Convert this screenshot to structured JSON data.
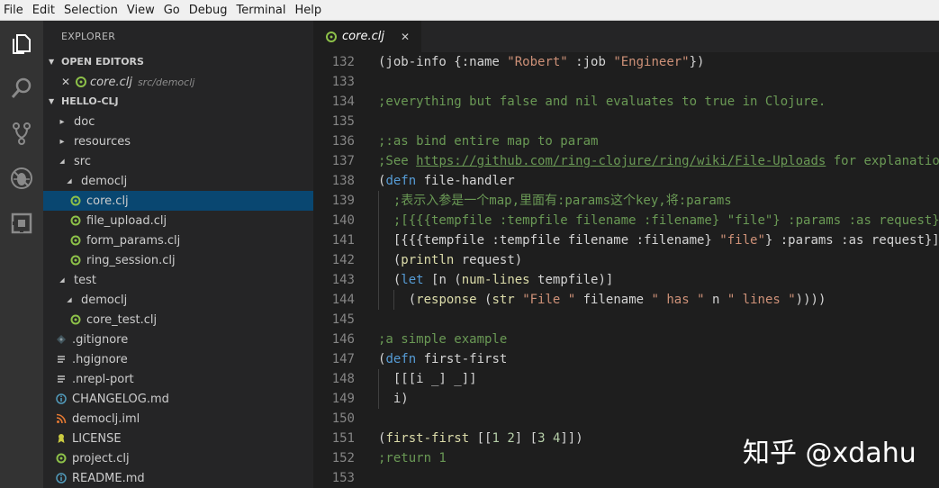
{
  "menu": [
    "File",
    "Edit",
    "Selection",
    "View",
    "Go",
    "Debug",
    "Terminal",
    "Help"
  ],
  "sidebar": {
    "title": "EXPLORER",
    "open_editors_label": "OPEN EDITORS",
    "open_editor": {
      "close_glyph": "✕",
      "name": "core.clj",
      "path": "src/democlj"
    },
    "project_label": "HELLO-CLJ",
    "tree": [
      {
        "label": "doc",
        "type": "folder-collapsed",
        "indent": 0
      },
      {
        "label": "resources",
        "type": "folder-collapsed",
        "indent": 0
      },
      {
        "label": "src",
        "type": "folder-open",
        "indent": 0
      },
      {
        "label": "democlj",
        "type": "folder-open",
        "indent": 1
      },
      {
        "label": "core.clj",
        "type": "clj",
        "indent": 2,
        "selected": true
      },
      {
        "label": "file_upload.clj",
        "type": "clj",
        "indent": 2
      },
      {
        "label": "form_params.clj",
        "type": "clj",
        "indent": 2
      },
      {
        "label": "ring_session.clj",
        "type": "clj",
        "indent": 2
      },
      {
        "label": "test",
        "type": "folder-open",
        "indent": 0
      },
      {
        "label": "democlj",
        "type": "folder-open",
        "indent": 1
      },
      {
        "label": "core_test.clj",
        "type": "clj",
        "indent": 2
      },
      {
        "label": ".gitignore",
        "type": "git",
        "indent": 0
      },
      {
        "label": ".hgignore",
        "type": "text",
        "indent": 0
      },
      {
        "label": ".nrepl-port",
        "type": "text",
        "indent": 0
      },
      {
        "label": "CHANGELOG.md",
        "type": "info",
        "indent": 0
      },
      {
        "label": "democlj.iml",
        "type": "rss",
        "indent": 0
      },
      {
        "label": "LICENSE",
        "type": "license",
        "indent": 0
      },
      {
        "label": "project.clj",
        "type": "clj",
        "indent": 0
      },
      {
        "label": "README.md",
        "type": "info",
        "indent": 0
      }
    ]
  },
  "tab": {
    "label": "core.clj",
    "close_glyph": "✕"
  },
  "editor": {
    "lines": [
      {
        "n": "132",
        "guides": 0,
        "tokens": [
          [
            "plain",
            "(job-info {:name "
          ],
          [
            "string",
            "\"Robert\""
          ],
          [
            "plain",
            " :job "
          ],
          [
            "string",
            "\"Engineer\""
          ],
          [
            "plain",
            "})"
          ]
        ]
      },
      {
        "n": "133",
        "guides": 0,
        "tokens": []
      },
      {
        "n": "134",
        "guides": 0,
        "tokens": [
          [
            "comment",
            ";everything but false and nil evaluates to true in Clojure."
          ]
        ]
      },
      {
        "n": "135",
        "guides": 0,
        "tokens": []
      },
      {
        "n": "136",
        "guides": 0,
        "tokens": [
          [
            "comment",
            ";:as bind entire map to param"
          ]
        ]
      },
      {
        "n": "137",
        "guides": 0,
        "tokens": [
          [
            "comment",
            ";See "
          ],
          [
            "link",
            "https://github.com/ring-clojure/ring/wiki/File-Uploads"
          ],
          [
            "comment",
            " for explanation"
          ]
        ]
      },
      {
        "n": "138",
        "guides": 0,
        "tokens": [
          [
            "plain",
            "("
          ],
          [
            "keyword",
            "defn"
          ],
          [
            "plain",
            " file-handler"
          ]
        ]
      },
      {
        "n": "139",
        "guides": 1,
        "tokens": [
          [
            "plain",
            "  "
          ],
          [
            "comment",
            ";表示入参是一个map,里面有:params这个key,将:params"
          ]
        ]
      },
      {
        "n": "140",
        "guides": 1,
        "tokens": [
          [
            "plain",
            "  "
          ],
          [
            "comment",
            ";[{{{tempfile :tempfile filename :filename} \"file\"} :params :as request}]"
          ]
        ]
      },
      {
        "n": "141",
        "guides": 1,
        "tokens": [
          [
            "plain",
            "  [{{{tempfile :tempfile filename :filename} "
          ],
          [
            "string",
            "\"file\""
          ],
          [
            "plain",
            "} :params :as request}]"
          ]
        ]
      },
      {
        "n": "142",
        "guides": 1,
        "tokens": [
          [
            "plain",
            "  ("
          ],
          [
            "func",
            "println"
          ],
          [
            "plain",
            " request)"
          ]
        ]
      },
      {
        "n": "143",
        "guides": 1,
        "tokens": [
          [
            "plain",
            "  ("
          ],
          [
            "keyword",
            "let"
          ],
          [
            "plain",
            " [n ("
          ],
          [
            "func",
            "num-lines"
          ],
          [
            "plain",
            " tempfile)]"
          ]
        ]
      },
      {
        "n": "144",
        "guides": 2,
        "tokens": [
          [
            "plain",
            "    ("
          ],
          [
            "func",
            "response"
          ],
          [
            "plain",
            " ("
          ],
          [
            "func",
            "str"
          ],
          [
            "plain",
            " "
          ],
          [
            "string",
            "\"File \""
          ],
          [
            "plain",
            " filename "
          ],
          [
            "string",
            "\" has \""
          ],
          [
            "plain",
            " n "
          ],
          [
            "string",
            "\" lines \""
          ],
          [
            "plain",
            "))))"
          ]
        ]
      },
      {
        "n": "145",
        "guides": 0,
        "tokens": []
      },
      {
        "n": "146",
        "guides": 0,
        "tokens": [
          [
            "comment",
            ";a simple example"
          ]
        ]
      },
      {
        "n": "147",
        "guides": 0,
        "tokens": [
          [
            "plain",
            "("
          ],
          [
            "keyword",
            "defn"
          ],
          [
            "plain",
            " first-first"
          ]
        ]
      },
      {
        "n": "148",
        "guides": 1,
        "tokens": [
          [
            "plain",
            "  [[[i _] _]]"
          ]
        ]
      },
      {
        "n": "149",
        "guides": 1,
        "tokens": [
          [
            "plain",
            "  i)"
          ]
        ]
      },
      {
        "n": "150",
        "guides": 0,
        "tokens": []
      },
      {
        "n": "151",
        "guides": 0,
        "tokens": [
          [
            "plain",
            "("
          ],
          [
            "func",
            "first-first"
          ],
          [
            "plain",
            " [["
          ],
          [
            "num",
            "1"
          ],
          [
            "plain",
            " "
          ],
          [
            "num",
            "2"
          ],
          [
            "plain",
            "] ["
          ],
          [
            "num",
            "3"
          ],
          [
            "plain",
            " "
          ],
          [
            "num",
            "4"
          ],
          [
            "plain",
            "]])"
          ]
        ]
      },
      {
        "n": "152",
        "guides": 0,
        "tokens": [
          [
            "comment",
            ";return 1"
          ]
        ]
      },
      {
        "n": "153",
        "guides": 0,
        "tokens": []
      }
    ]
  },
  "watermark": "知乎 @xdahu",
  "colors": {
    "clj_icon": "#8dc149",
    "folder_twisty": "#c5c5c5",
    "git_icon": "#41535b",
    "text_icon": "#cccccc",
    "info_icon": "#519aba",
    "rss_icon": "#e37933",
    "license_icon": "#cbcb41",
    "selection": "#094771"
  }
}
